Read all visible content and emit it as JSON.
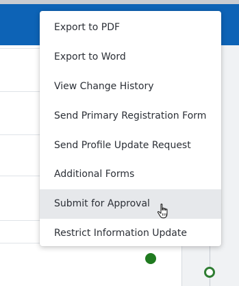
{
  "menu": {
    "items": [
      {
        "label": "Export to PDF"
      },
      {
        "label": "Export to Word"
      },
      {
        "label": "View Change History"
      },
      {
        "label": "Send Primary Registration Form"
      },
      {
        "label": "Send Profile Update Request"
      },
      {
        "label": "Additional Forms"
      },
      {
        "label": "Submit for Approval",
        "hovered": true
      },
      {
        "label": "Restrict Information Update"
      }
    ]
  },
  "status": {
    "indicator_color": "#1f7a1f"
  },
  "cursor": {
    "icon": "hand-pointer-icon"
  }
}
